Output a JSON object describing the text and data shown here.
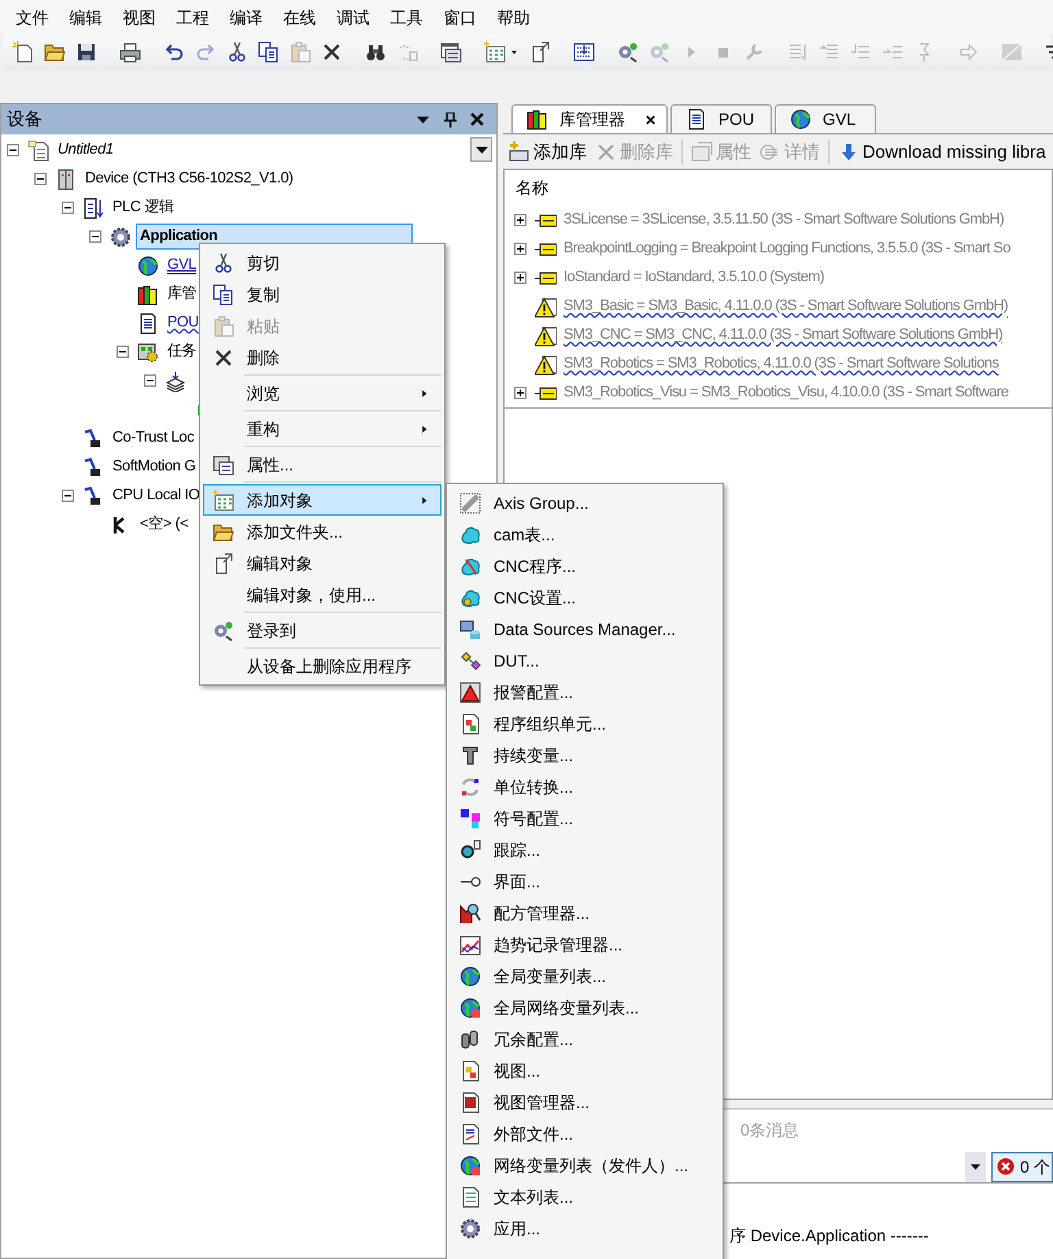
{
  "menu_bar": [
    "文件",
    "编辑",
    "视图",
    "工程",
    "编译",
    "在线",
    "调试",
    "工具",
    "窗口",
    "帮助"
  ],
  "toolbar": [
    {
      "kind": "button",
      "disabled": false
    },
    {
      "kind": "button",
      "disabled": false
    },
    {
      "kind": "button",
      "disabled": false
    },
    {
      "kind": "separator"
    },
    {
      "kind": "button",
      "disabled": false
    },
    {
      "kind": "separator"
    },
    {
      "kind": "button",
      "disabled": false
    },
    {
      "kind": "button",
      "disabled": true
    },
    {
      "kind": "button",
      "disabled": false
    },
    {
      "kind": "button",
      "disabled": false
    },
    {
      "kind": "button",
      "disabled": true
    },
    {
      "kind": "button",
      "disabled": false
    },
    {
      "kind": "separator"
    },
    {
      "kind": "button",
      "disabled": false
    },
    {
      "kind": "button",
      "disabled": true
    },
    {
      "kind": "separator"
    },
    {
      "kind": "button",
      "disabled": false
    },
    {
      "kind": "separator"
    },
    {
      "kind": "button",
      "disabled": false
    },
    {
      "kind": "button",
      "disabled": false
    },
    {
      "kind": "separator"
    },
    {
      "kind": "button",
      "disabled": false
    },
    {
      "kind": "separator"
    },
    {
      "kind": "button",
      "disabled": false
    },
    {
      "kind": "button",
      "disabled": true
    },
    {
      "kind": "button",
      "disabled": true
    },
    {
      "kind": "button",
      "disabled": true
    },
    {
      "kind": "button",
      "disabled": true
    },
    {
      "kind": "separator"
    },
    {
      "kind": "button",
      "disabled": true
    },
    {
      "kind": "button",
      "disabled": true
    },
    {
      "kind": "button",
      "disabled": true
    },
    {
      "kind": "button",
      "disabled": true
    },
    {
      "kind": "button",
      "disabled": true
    },
    {
      "kind": "separator"
    },
    {
      "kind": "button",
      "disabled": true
    },
    {
      "kind": "separator"
    },
    {
      "kind": "button",
      "disabled": true
    },
    {
      "kind": "separator"
    },
    {
      "kind": "button",
      "disabled": false
    }
  ],
  "devices_panel": {
    "title": "设备",
    "tree": [
      {
        "label": "Untitled1",
        "kind": "project",
        "selected": false,
        "expanded": true,
        "children": [
          {
            "label": "Device (CTH3 C56-102S2_V1.0)",
            "kind": "device",
            "selected": false,
            "expanded": true,
            "children": [
              {
                "label": "PLC 逻辑",
                "kind": "plc",
                "selected": false,
                "expanded": true,
                "children": [
                  {
                    "label": "Application",
                    "kind": "application",
                    "selected": true,
                    "expanded": true,
                    "children": [
                      {
                        "label": "GVL",
                        "kind": "gvl",
                        "selected": false
                      },
                      {
                        "label": "库管",
                        "kind": "library",
                        "selected": false
                      },
                      {
                        "label": "POU",
                        "kind": "pou",
                        "selected": false
                      },
                      {
                        "label": "任务",
                        "kind": "task-config",
                        "selected": false,
                        "expanded": true,
                        "children": [
                          {
                            "kind": "task",
                            "selected": false,
                            "expanded": true,
                            "children": [
                              {
                                "kind": "program",
                                "selected": false
                              }
                            ]
                          }
                        ]
                      }
                    ]
                  }
                ]
              },
              {
                "label": "Co-Trust Loc",
                "kind": "fieldbus",
                "selected": false
              },
              {
                "label": "SoftMotion G",
                "kind": "fieldbus",
                "selected": false
              },
              {
                "label": "CPU Local IO",
                "kind": "fieldbus",
                "selected": false,
                "expanded": true,
                "children": [
                  {
                    "label": "<空> (<",
                    "kind": "slot",
                    "selected": false
                  }
                ]
              }
            ]
          }
        ]
      }
    ]
  },
  "editor_tabs": [
    {
      "label": "库管理器",
      "selected": true
    },
    {
      "label": "POU",
      "selected": false
    },
    {
      "label": "GVL",
      "selected": false
    }
  ],
  "library_toolbar": [
    {
      "label": "添加库",
      "disabled": false
    },
    {
      "label": "删除库",
      "disabled": true
    },
    {
      "label": "属性",
      "disabled": true
    },
    {
      "label": "详情",
      "disabled": true
    },
    {
      "label": "Download missing libra",
      "disabled": false
    }
  ],
  "library_list": {
    "column": "名称",
    "rows": [
      {
        "label": "3SLicense = 3SLicense, 3.5.11.50 (3S - Smart Software Solutions GmbH)",
        "kind": "library",
        "expandable": true
      },
      {
        "label": "BreakpointLogging = Breakpoint Logging Functions, 3.5.5.0 (3S - Smart So",
        "kind": "library",
        "expandable": true
      },
      {
        "label": "IoStandard = IoStandard, 3.5.10.0 (System)",
        "kind": "library",
        "expandable": true
      },
      {
        "label": "SM3_Basic = SM3_Basic, 4.11.0.0 (3S - Smart Software Solutions GmbH)",
        "kind": "warning",
        "expandable": false
      },
      {
        "label": "SM3_CNC = SM3_CNC, 4.11.0.0 (3S - Smart Software Solutions GmbH)",
        "kind": "warning",
        "expandable": false
      },
      {
        "label": "SM3_Robotics = SM3_Robotics, 4.11.0.0 (3S - Smart Software Solutions",
        "kind": "warning",
        "expandable": false
      },
      {
        "label": "SM3_Robotics_Visu = SM3_Robotics_Visu, 4.10.0.0 (3S - Smart Software",
        "kind": "library",
        "expandable": true
      }
    ]
  },
  "messages": {
    "summary": "0条消息",
    "errors_button": "0 个",
    "log_line": "序 Device.Application -------"
  },
  "context_menu": {
    "items": [
      {
        "kind": "item",
        "label": "剪切",
        "disabled": false,
        "selected": false,
        "submenu": false
      },
      {
        "kind": "item",
        "label": "复制",
        "disabled": false,
        "selected": false,
        "submenu": false
      },
      {
        "kind": "item",
        "label": "粘贴",
        "disabled": true,
        "selected": false,
        "submenu": false
      },
      {
        "kind": "item",
        "label": "删除",
        "disabled": false,
        "selected": false,
        "submenu": false
      },
      {
        "kind": "separator"
      },
      {
        "kind": "item",
        "label": "浏览",
        "disabled": false,
        "selected": false,
        "submenu": true
      },
      {
        "kind": "separator"
      },
      {
        "kind": "item",
        "label": "重构",
        "disabled": false,
        "selected": false,
        "submenu": true
      },
      {
        "kind": "separator"
      },
      {
        "kind": "item",
        "label": "属性...",
        "disabled": false,
        "selected": false,
        "submenu": false
      },
      {
        "kind": "separator"
      },
      {
        "kind": "item",
        "label": "添加对象",
        "disabled": false,
        "selected": true,
        "submenu": true
      },
      {
        "kind": "item",
        "label": "添加文件夹...",
        "disabled": false,
        "selected": false,
        "submenu": false
      },
      {
        "kind": "item",
        "label": "编辑对象",
        "disabled": false,
        "selected": false,
        "submenu": false
      },
      {
        "kind": "item",
        "label": "编辑对象，使用...",
        "disabled": false,
        "selected": false,
        "submenu": false
      },
      {
        "kind": "separator"
      },
      {
        "kind": "item",
        "label": "登录到",
        "disabled": false,
        "selected": false,
        "submenu": false
      },
      {
        "kind": "separator"
      },
      {
        "kind": "item",
        "label": "从设备上删除应用程序",
        "disabled": false,
        "selected": false,
        "submenu": false
      }
    ]
  },
  "submenu": {
    "items": [
      "Axis Group...",
      "cam表...",
      "CNC程序...",
      "CNC设置...",
      "Data Sources Manager...",
      "DUT...",
      "报警配置...",
      "程序组织单元...",
      "持续变量...",
      "单位转换...",
      "符号配置...",
      "跟踪...",
      "界面...",
      "配方管理器...",
      "趋势记录管理器...",
      "全局变量列表...",
      "全局网络变量列表...",
      "冗余配置...",
      "视图...",
      "视图管理器...",
      "外部文件...",
      "网络变量列表（发件人）...",
      "文本列表...",
      "应用..."
    ]
  }
}
